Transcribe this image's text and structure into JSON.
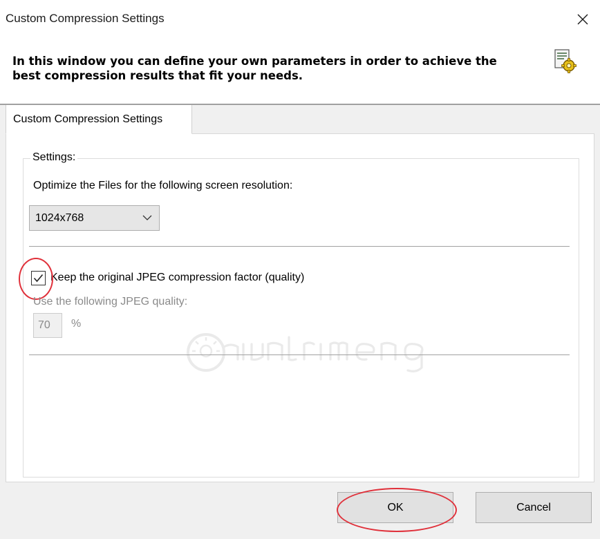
{
  "window": {
    "title": "Custom Compression Settings",
    "close_icon": "close-icon"
  },
  "header": {
    "description": "In this window you can define your own parameters in order to achieve the best compression results that fit your needs.",
    "icon": "settings-gear-icon"
  },
  "tabs": [
    {
      "label": "Custom Compression Settings",
      "active": true
    }
  ],
  "settings": {
    "group_label": "Settings:",
    "resolution_label": "Optimize the Files for the following screen resolution:",
    "resolution_value": "1024x768",
    "keep_original_label": "Keep the original JPEG compression factor (quality)",
    "keep_original_checked": true,
    "quality_label": "Use the following JPEG quality:",
    "quality_value": "70",
    "quality_unit": "%",
    "quality_enabled": false
  },
  "buttons": {
    "ok": "OK",
    "cancel": "Cancel"
  },
  "watermark": "Quantrimang",
  "colors": {
    "highlight": "#e0303a",
    "disabled_text": "#8a8a8a"
  }
}
